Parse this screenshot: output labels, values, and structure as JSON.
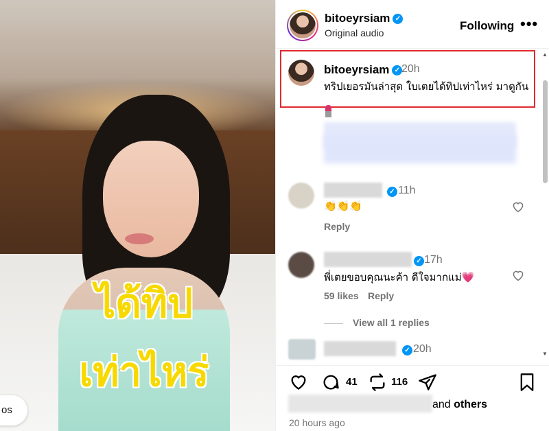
{
  "media": {
    "overlay_line1": "ได้ทิป",
    "overlay_line2": "เท่าไหร่",
    "pill_text": "os"
  },
  "header": {
    "username": "bitoeyrsiam",
    "subtitle": "Original audio",
    "following_label": "Following",
    "more_label": "•••"
  },
  "caption": {
    "username": "bitoeyrsiam",
    "time": "20h",
    "text": "ทริปเยอรมันล่าสุด ใบเตยได้ทิปเท่าไหร่ มาดูกัน",
    "emoji": "lipstick-emoji"
  },
  "comments": [
    {
      "time": "11h",
      "text": "👏👏👏",
      "reply_label": "Reply"
    },
    {
      "time": "17h",
      "text": "พี่เตยขอบคุณนะค้า ดีใจมากแม่💗",
      "likes_label": "59 likes",
      "reply_label": "Reply",
      "view_replies": "View all 1 replies"
    },
    {
      "time": "20h"
    }
  ],
  "actions": {
    "comment_count": "41",
    "repost_count": "116"
  },
  "likes": {
    "suffix_and": "and",
    "suffix_others": "others"
  },
  "date": "20 hours ago",
  "colors": {
    "verified": "#0095f6",
    "highlight_border": "#e0282e",
    "muted": "#737373"
  }
}
